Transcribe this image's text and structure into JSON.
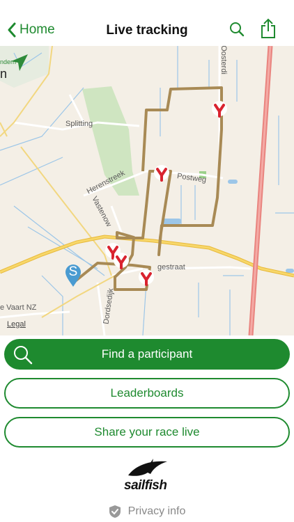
{
  "header": {
    "back_label": "Home",
    "title": "Live tracking",
    "back_icon": "chevron-left-icon",
    "search_icon": "search-icon",
    "share_icon": "share-icon",
    "accent_color": "#1e8a2f"
  },
  "map": {
    "labels": {
      "splitting": "Splitting",
      "herenstreek": "Herenstreek",
      "vastenow": "Vastenow",
      "postweg": "Postweg",
      "gestraat": "gestraat",
      "dordsedijk": "Dordsedijk",
      "vaart": "e Vaart NZ",
      "oosterdijk": "Oosterdi",
      "edge_letter": "n",
      "edge_green": "ndern"
    },
    "start_marker": "S",
    "legal": "Legal",
    "route_color": "#a88a55",
    "marker_color": "#d9232f"
  },
  "buttons": {
    "find": "Find a participant",
    "leaderboards": "Leaderboards",
    "share": "Share your race live"
  },
  "logo": {
    "text": "sailfish"
  },
  "footer": {
    "privacy": "Privacy info"
  }
}
